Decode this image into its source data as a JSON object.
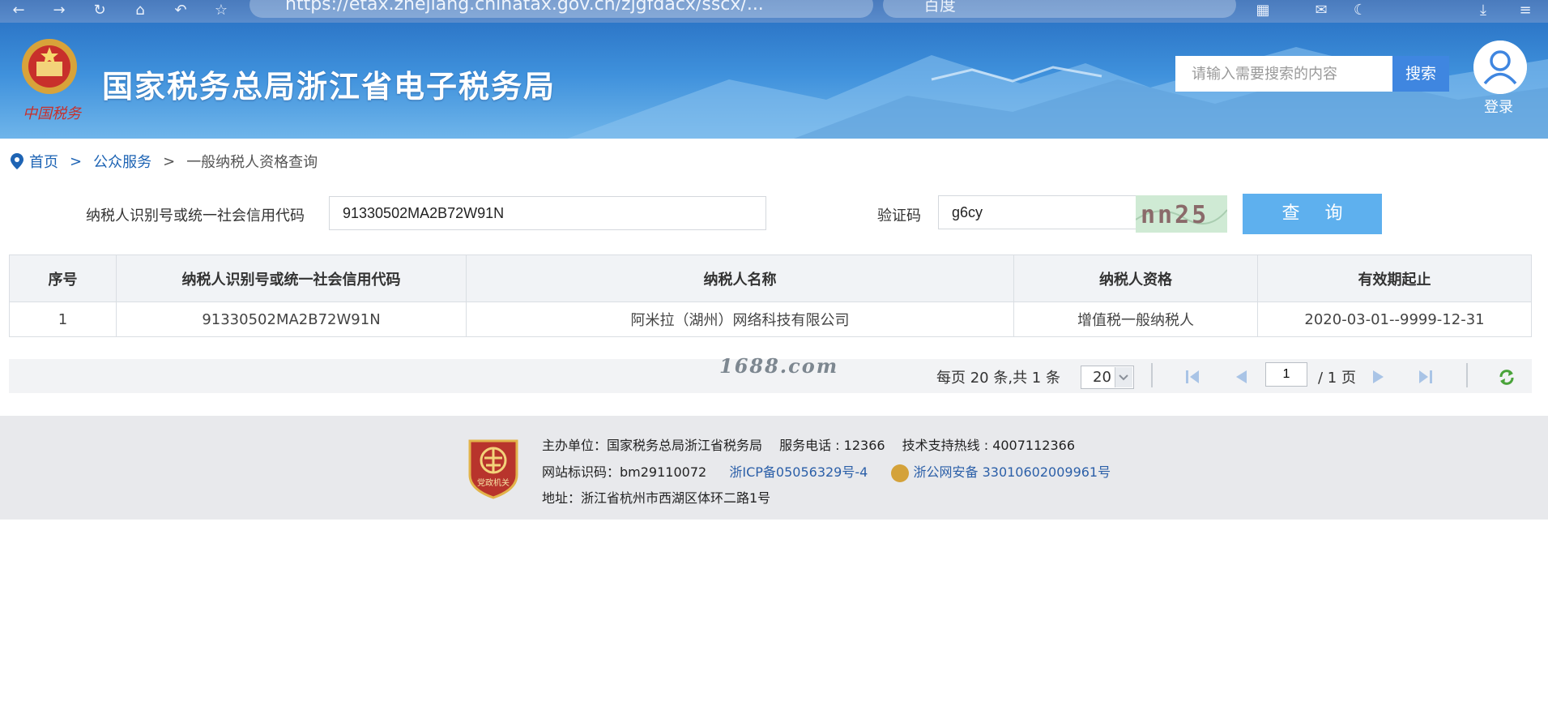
{
  "browser": {
    "url": "https://etax.zhejiang.chinatax.gov.cn/zjgfdacx/sscx/...",
    "search_engine": "百度"
  },
  "header": {
    "site_title": "国家税务总局浙江省电子税务局",
    "search_placeholder": "请输入需要搜索的内容",
    "search_button": "搜索",
    "login_label": "登录"
  },
  "breadcrumb": {
    "items": [
      "首页",
      "公众服务",
      "一般纳税人资格查询"
    ],
    "separator": ">"
  },
  "form": {
    "taxpayer_id_label": "纳税人识别号或统一社会信用代码",
    "taxpayer_id_value": "91330502MA2B72W91N",
    "captcha_label": "验证码",
    "captcha_value": "g6cy",
    "captcha_image_text": "nn25",
    "query_button": "查 询"
  },
  "table": {
    "headers": [
      "序号",
      "纳税人识别号或统一社会信用代码",
      "纳税人名称",
      "纳税人资格",
      "有效期起止"
    ],
    "rows": [
      [
        "1",
        "91330502MA2B72W91N",
        "阿米拉（湖州）网络科技有限公司",
        "增值税一般纳税人",
        "2020-03-01--9999-12-31"
      ]
    ]
  },
  "pager": {
    "summary": "每页 20 条,共 1 条",
    "page_size": "20",
    "current_page": "1",
    "total_pages": "/ 1 页"
  },
  "watermark": "1688.com",
  "footer": {
    "line1": "主办单位：国家税务总局浙江省税务局　 服务电话 : 12366　 技术支持热线 : 4007112366",
    "site_id": "网站标识码：bm29110072",
    "icp": "浙ICP备05056329号-4",
    "police": "浙公网安备 33010602009961号",
    "address": "地址：浙江省杭州市西湖区体环二路1号",
    "party_logo_text": "党政机关"
  },
  "colors": {
    "banner": "#3f91dc",
    "query_button": "#5eb0ee",
    "link": "#1e64b4"
  }
}
